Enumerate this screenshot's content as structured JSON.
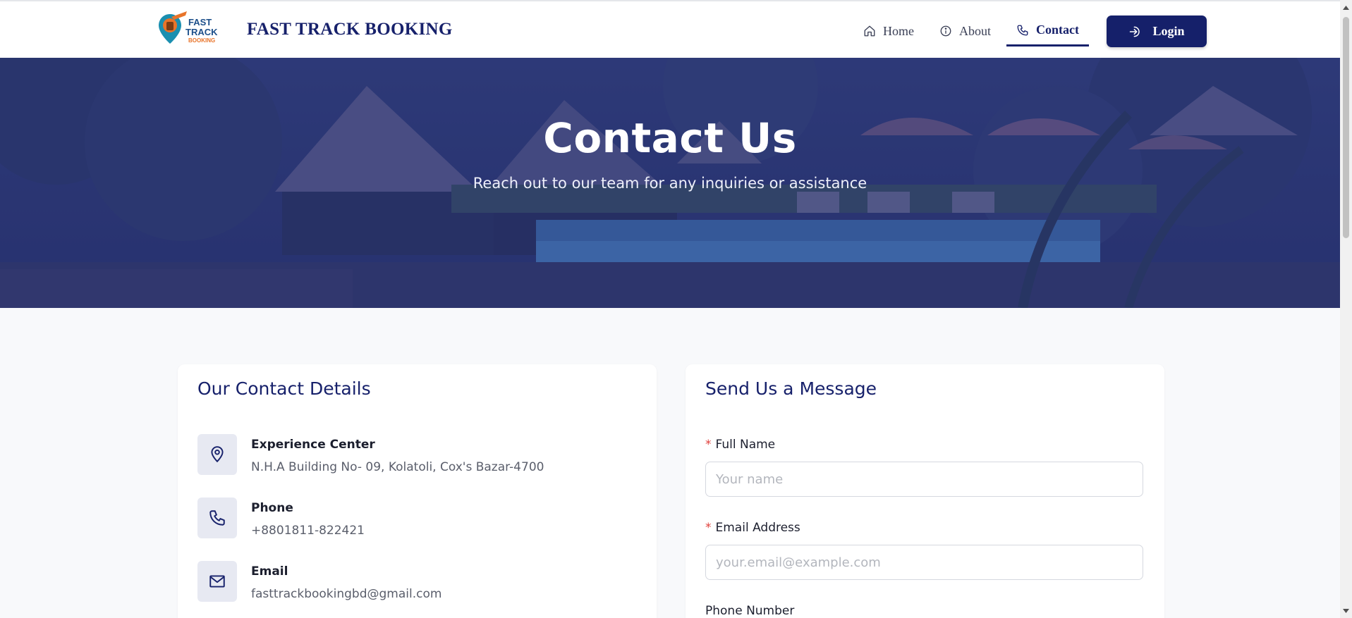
{
  "header": {
    "logo_text_line1": "FAST",
    "logo_text_line2": "TRACK",
    "logo_text_line3": "BOOKING",
    "brand": "FAST TRACK BOOKING",
    "nav": [
      {
        "label": "Home",
        "icon": "home-icon"
      },
      {
        "label": "About",
        "icon": "info-icon"
      },
      {
        "label": "Contact",
        "icon": "phone-icon",
        "active": true
      }
    ],
    "login_label": "Login"
  },
  "hero": {
    "title": "Contact Us",
    "subtitle": "Reach out to our team for any inquiries or assistance"
  },
  "contact_details": {
    "title": "Our Contact Details",
    "items": [
      {
        "icon": "location-pin-icon",
        "label": "Experience Center",
        "value": "N.H.A Building No- 09, Kolatoli, Cox's Bazar-4700"
      },
      {
        "icon": "phone-icon",
        "label": "Phone",
        "value": "+8801811-822421"
      },
      {
        "icon": "mail-icon",
        "label": "Email",
        "value": "fasttrackbookingbd@gmail.com"
      }
    ]
  },
  "message_form": {
    "title": "Send Us a Message",
    "required_mark": "*",
    "full_name": {
      "label": "Full Name",
      "placeholder": "Your name",
      "value": ""
    },
    "email": {
      "label": "Email Address",
      "placeholder": "your.email@example.com",
      "value": ""
    },
    "phone": {
      "label": "Phone Number"
    }
  },
  "colors": {
    "brand_navy": "#17216b",
    "button_navy": "#15206a",
    "required_red": "#e0403c",
    "page_bg": "#f8f9fb"
  }
}
